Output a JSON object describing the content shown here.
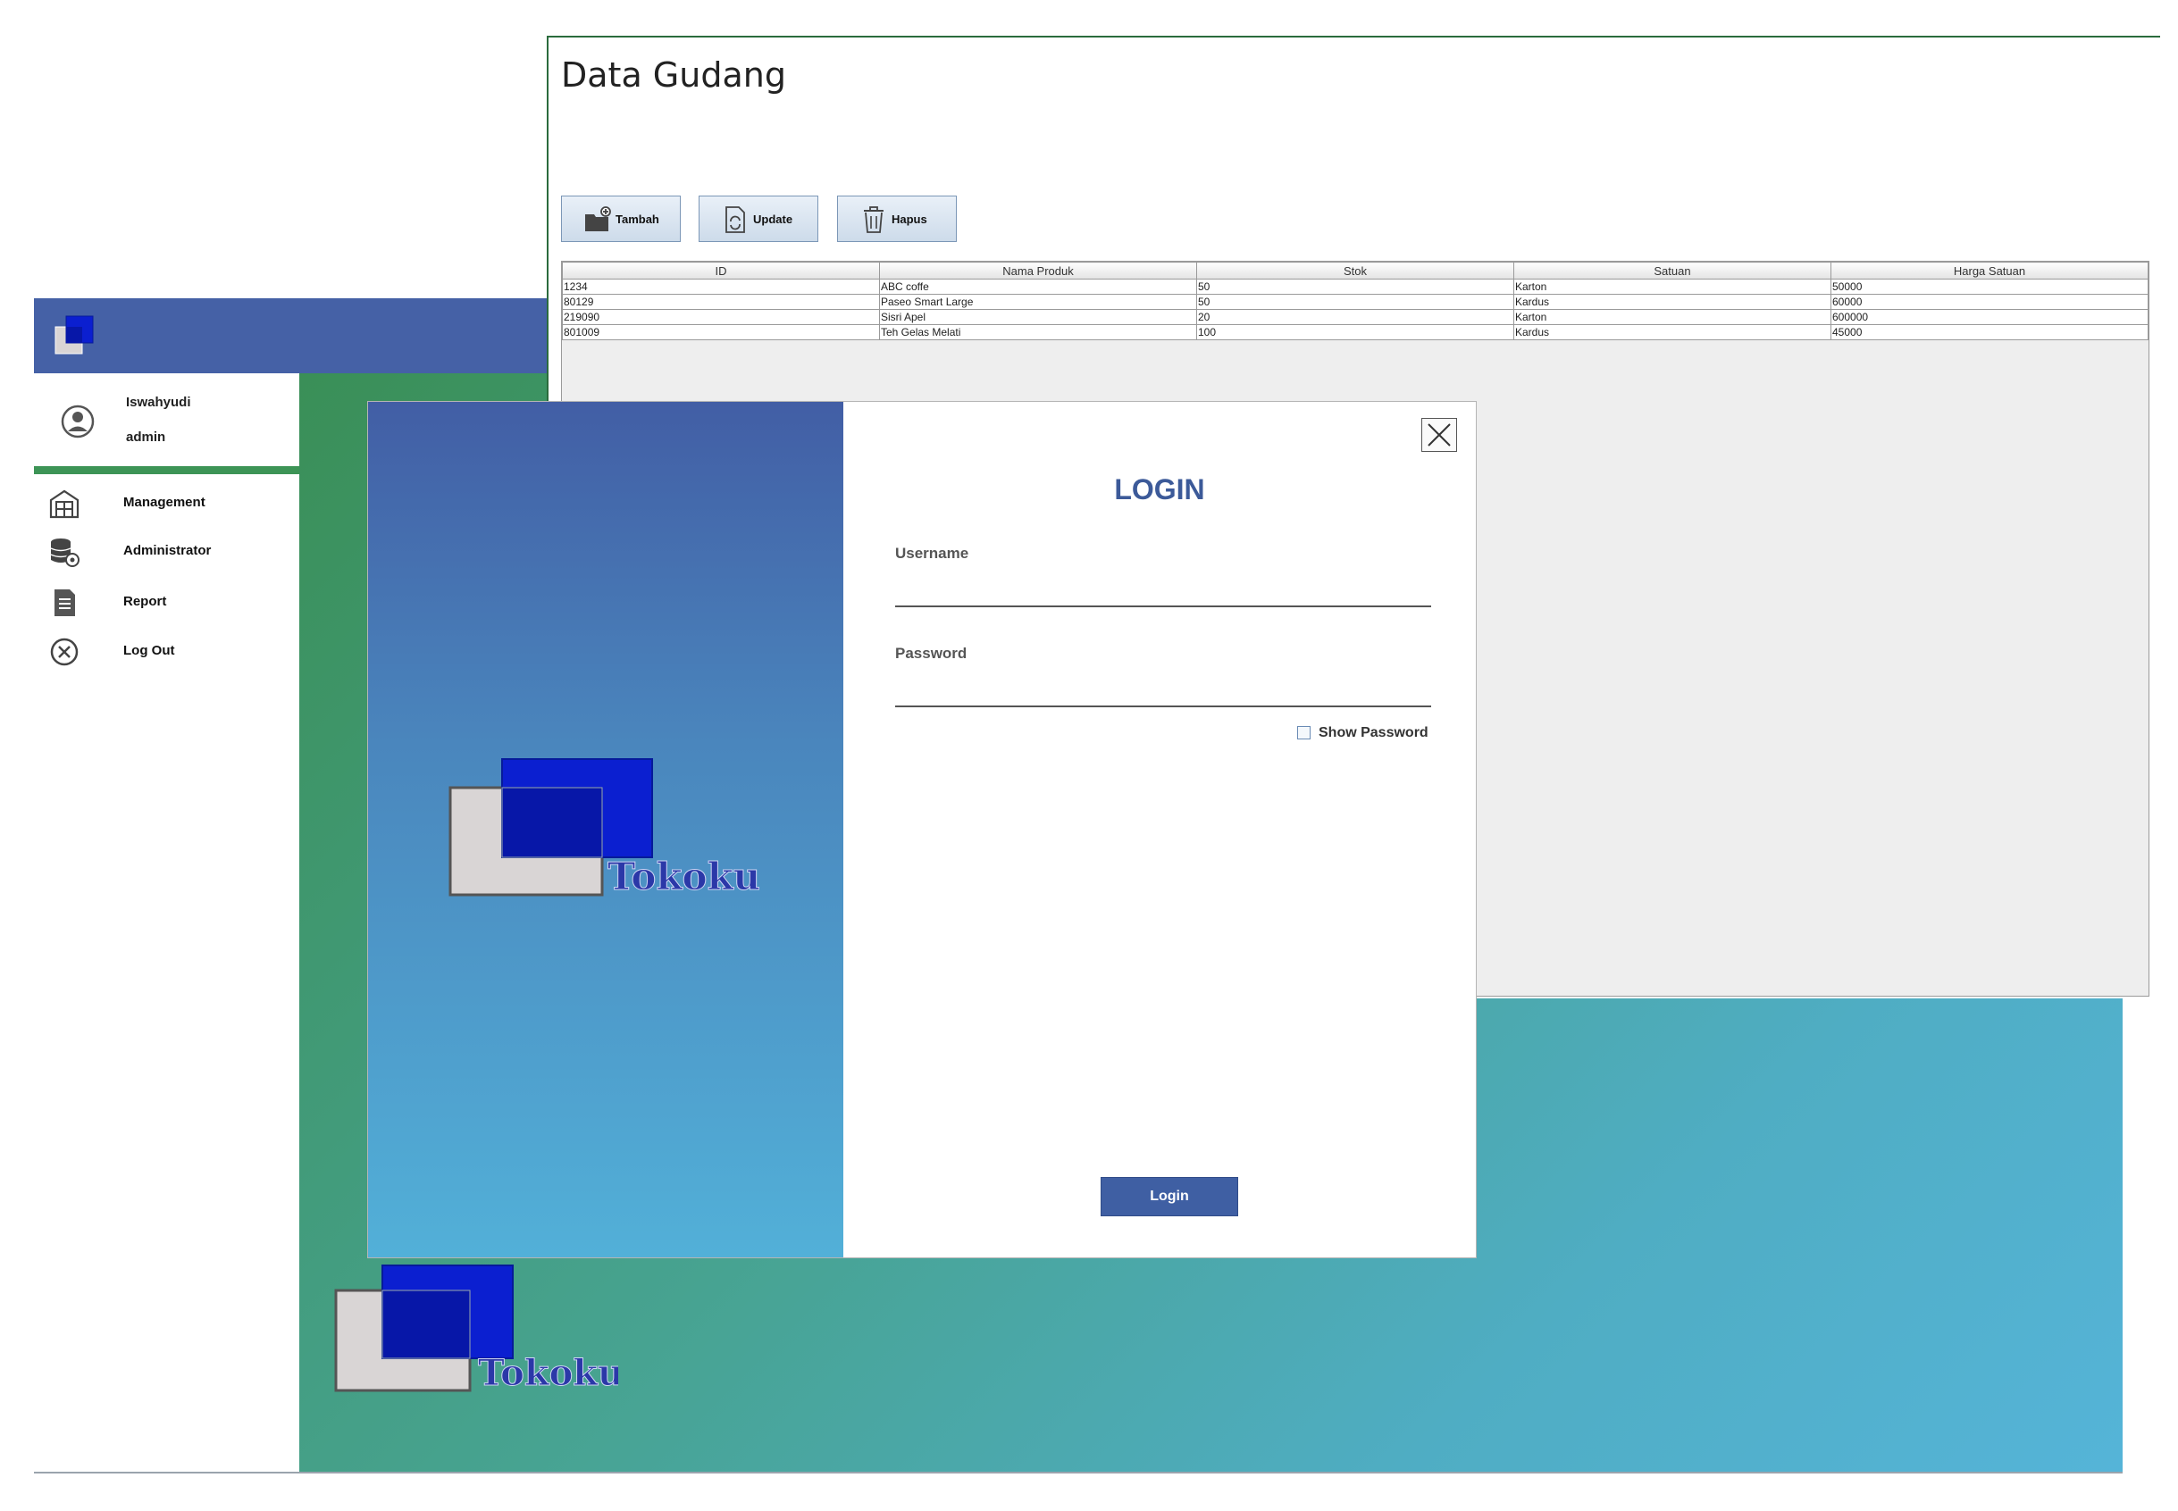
{
  "dashboard": {
    "user": {
      "name": "Iswahyudi",
      "role": "admin"
    },
    "menu": [
      {
        "label": "Management",
        "icon": "warehouse-icon"
      },
      {
        "label": "Administrator",
        "icon": "database-gear-icon"
      },
      {
        "label": "Report",
        "icon": "document-icon"
      },
      {
        "label": "Log Out",
        "icon": "close-circle-icon"
      }
    ],
    "brand": "Tokoku"
  },
  "gudang": {
    "title": "Data Gudang",
    "buttons": {
      "add": "Tambah",
      "update": "Update",
      "delete": "Hapus"
    },
    "columns": [
      "ID",
      "Nama Produk",
      "Stok",
      "Satuan",
      "Harga Satuan"
    ],
    "rows": [
      [
        "1234",
        "ABC coffe",
        "50",
        "Karton",
        "50000"
      ],
      [
        "80129",
        "Paseo Smart Large",
        "50",
        "Kardus",
        "60000"
      ],
      [
        "219090",
        "Sisri Apel",
        "20",
        "Karton",
        "600000"
      ],
      [
        "801009",
        "Teh Gelas Melati",
        "100",
        "Kardus",
        "45000"
      ]
    ]
  },
  "login": {
    "title": "LOGIN",
    "brand": "Tokoku",
    "username_label": "Username",
    "username_value": "",
    "password_label": "Password",
    "password_value": "",
    "show_password_label": "Show Password",
    "show_password_checked": false,
    "submit_label": "Login"
  },
  "colors": {
    "header_blue": "#4561a6",
    "sidebar_green": "#3d9456",
    "login_title": "#3c5a99",
    "login_button": "#3f5fa3"
  }
}
